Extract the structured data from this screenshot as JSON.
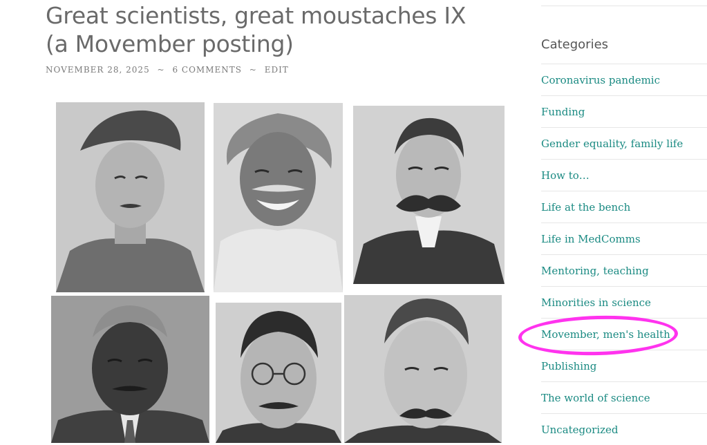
{
  "post": {
    "title": "Great scientists, great moustaches IX (a Movember posting)",
    "date": "NOVEMBER 28, 2025",
    "separator": "~",
    "comments": "6 COMMENTS",
    "edit": "EDIT"
  },
  "photos": [
    "scientist-portrait-flat-cap",
    "scientist-portrait-white-hair",
    "scientist-portrait-victorian",
    "scientist-portrait-suit-tie",
    "scientist-portrait-round-glasses",
    "scientist-portrait-edwardian"
  ],
  "sidebar": {
    "widget_title": "Categories",
    "categories": [
      "Coronavirus pandemic",
      "Funding",
      "Gender equality, family life",
      "How to…",
      "Life at the bench",
      "Life in MedComms",
      "Mentoring, teaching",
      "Minorities in science",
      "Movember, men's health",
      "Publishing",
      "The world of science",
      "Uncategorized"
    ]
  },
  "colors": {
    "link": "#1a8a82",
    "title": "#6a6a6a",
    "highlight": "#ff33ee"
  }
}
